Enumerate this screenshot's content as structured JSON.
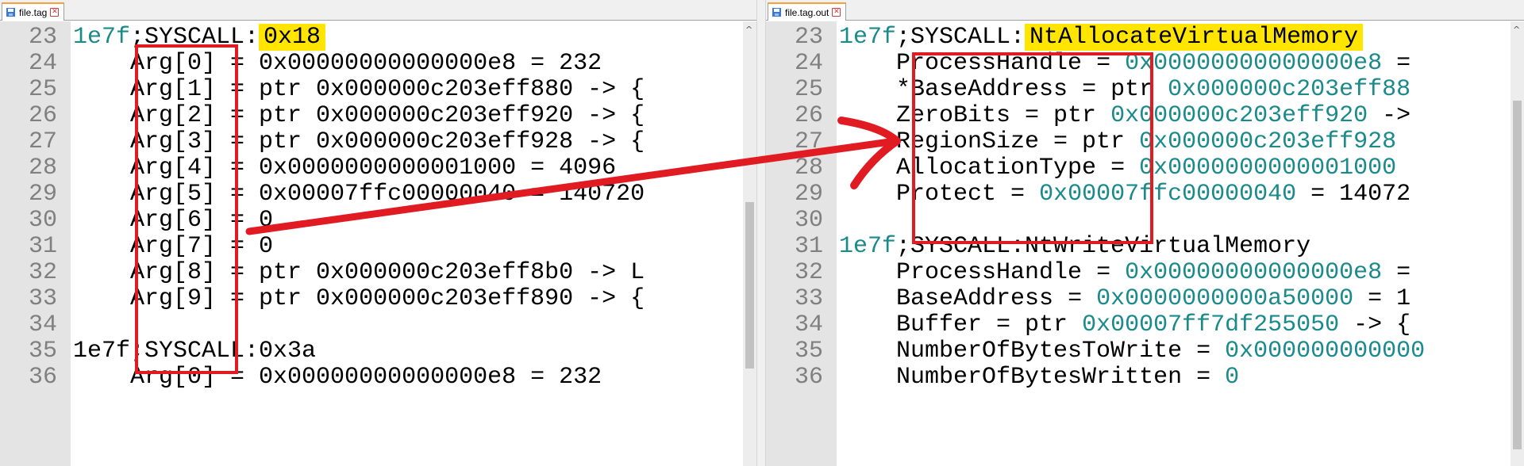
{
  "left": {
    "tab": {
      "label": "file.tag",
      "icon": "file-icon",
      "close_icon": "close-icon"
    },
    "line_numbers": [
      "23",
      "24",
      "25",
      "26",
      "27",
      "28",
      "29",
      "30",
      "31",
      "32",
      "33",
      "34",
      "35",
      "36"
    ],
    "lines": [
      {
        "indent": "",
        "prefix": "1e7f",
        "rest": ";SYSCALL:",
        "highlight": "0x18"
      },
      {
        "indent": "    ",
        "text": "Arg[0] = 0x00000000000000e8 = 232"
      },
      {
        "indent": "    ",
        "text": "Arg[1] = ptr 0x000000c203eff880 -> {"
      },
      {
        "indent": "    ",
        "text": "Arg[2] = ptr 0x000000c203eff920 -> {"
      },
      {
        "indent": "    ",
        "text": "Arg[3] = ptr 0x000000c203eff928 -> {"
      },
      {
        "indent": "    ",
        "text": "Arg[4] = 0x0000000000001000 = 4096"
      },
      {
        "indent": "    ",
        "text": "Arg[5] = 0x00007ffc00000040 = 140720"
      },
      {
        "indent": "    ",
        "text": "Arg[6] = 0"
      },
      {
        "indent": "    ",
        "text": "Arg[7] = 0"
      },
      {
        "indent": "    ",
        "text": "Arg[8] = ptr 0x000000c203eff8b0 -> L"
      },
      {
        "indent": "    ",
        "text": "Arg[9] = ptr 0x000000c203eff890 -> {"
      },
      {
        "indent": "",
        "text": ""
      },
      {
        "indent": "",
        "text": "1e7f;SYSCALL:0x3a"
      },
      {
        "indent": "    ",
        "text": "Arg[0] = 0x00000000000000e8 = 232"
      }
    ]
  },
  "right": {
    "tab": {
      "label": "file.tag.out",
      "icon": "file-icon",
      "close_icon": "close-icon"
    },
    "line_numbers": [
      "23",
      "24",
      "25",
      "26",
      "27",
      "28",
      "29",
      "30",
      "31",
      "32",
      "33",
      "34",
      "35",
      "36"
    ],
    "lines": [
      {
        "indent": "",
        "prefix": "1e7f",
        "rest": ";SYSCALL:",
        "highlight": "NtAllocateVirtualMemory"
      },
      {
        "indent": "    ",
        "name": "ProcessHandle",
        "op": " = ",
        "value": "0x00000000000000e8",
        "tail": " ="
      },
      {
        "indent": "    ",
        "name": "*BaseAddress",
        "op": " = ptr ",
        "value": "0x000000c203eff88",
        "tail": ""
      },
      {
        "indent": "    ",
        "name": "ZeroBits",
        "op": " = ptr ",
        "value": "0x000000c203eff920",
        "tail": " ->"
      },
      {
        "indent": "    ",
        "name": "RegionSize",
        "op": " = ptr ",
        "value": "0x000000c203eff928",
        "tail": ""
      },
      {
        "indent": "    ",
        "name": "AllocationType",
        "op": " = ",
        "value": "0x0000000000001000",
        "tail": ""
      },
      {
        "indent": "    ",
        "name": "Protect",
        "op": " = ",
        "value": "0x00007ffc00000040",
        "tail": " = 14072"
      },
      {
        "indent": "",
        "name": "",
        "op": "",
        "value": "",
        "tail": ""
      },
      {
        "indent": "",
        "prefix": "1e7f",
        "rest": ";SYSCALL:NtWriteVirtualMemory"
      },
      {
        "indent": "    ",
        "name": "ProcessHandle",
        "op": " = ",
        "value": "0x00000000000000e8",
        "tail": " ="
      },
      {
        "indent": "    ",
        "name": "BaseAddress",
        "op": " = ",
        "value": "0x0000000000a50000",
        "tail": " = 1"
      },
      {
        "indent": "    ",
        "name": "Buffer",
        "op": " = ptr ",
        "value": "0x00007ff7df255050",
        "tail": " -> {"
      },
      {
        "indent": "    ",
        "name": "NumberOfBytesToWrite",
        "op": " = ",
        "value": "0x000000000000",
        "tail": ""
      },
      {
        "indent": "    ",
        "name": "NumberOfBytesWritten",
        "op": " = ",
        "value": "0",
        "tail": ""
      }
    ]
  },
  "colors": {
    "highlight": "#ffe500",
    "annotation_red": "#e11b22",
    "tag_teal": "#1a8a8a",
    "gutter": "#e4e4e4"
  },
  "annotations": {
    "left_box": "red-rectangle",
    "right_box": "red-rectangle",
    "arrow": "red-arrow"
  }
}
